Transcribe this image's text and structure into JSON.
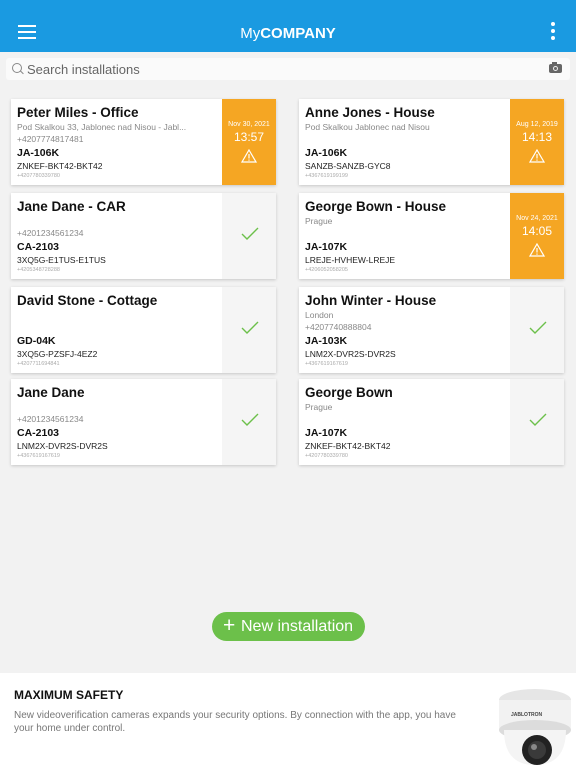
{
  "header": {
    "brand_light": "My",
    "brand_bold": "COMPANY",
    "background": "#1a9ae1"
  },
  "search": {
    "placeholder": "Search installations"
  },
  "installations": [
    {
      "title": "Peter Miles - Office",
      "address": "Pod Skalkou 33, Jablonec nad Nisou - Jabl...",
      "phone": "+4207774817481",
      "model": "JA-106K",
      "code": "ZNKEF-BKT42-BKT42",
      "tiny": "+4207780339780",
      "status": "alert",
      "date": "Nov 30, 2021",
      "time": "13:57"
    },
    {
      "title": "Anne Jones - House",
      "address": "Pod Skalkou Jablonec nad Nisou",
      "phone": "",
      "model": "JA-106K",
      "code": "SANZB-SANZB-GYC8",
      "tiny": "+4367619199199",
      "status": "alert",
      "date": "Aug 12, 2019",
      "time": "14:13"
    },
    {
      "title": "Jane Dane - CAR",
      "address": "",
      "phone": "+4201234561234",
      "model": "CA-2103",
      "code": "3XQ5G-E1TUS-E1TUS",
      "tiny": "+4205348728288",
      "status": "ok"
    },
    {
      "title": "George Bown - House",
      "address": "Prague",
      "phone": "",
      "model": "JA-107K",
      "code": "LREJE-HVHEW-LREJE",
      "tiny": "+4206052058205",
      "status": "alert",
      "date": "Nov 24, 2021",
      "time": "14:05"
    },
    {
      "title": "David Stone - Cottage",
      "address": "",
      "phone": "",
      "model": "GD-04K",
      "code": "3XQ5G-PZSFJ-4EZ2",
      "tiny": "+4207711694841",
      "status": "ok"
    },
    {
      "title": "John Winter - House",
      "address": "London",
      "phone": "+4207740888804",
      "model": "JA-103K",
      "code": "LNM2X-DVR2S-DVR2S",
      "tiny": "+4367619167619",
      "status": "ok"
    },
    {
      "title": "Jane Dane",
      "address": "",
      "phone": "+4201234561234",
      "model": "CA-2103",
      "code": "LNM2X-DVR2S-DVR2S",
      "tiny": "+4367619167619",
      "status": "ok"
    },
    {
      "title": "George Bown",
      "address": "Prague",
      "phone": "",
      "model": "JA-107K",
      "code": "ZNKEF-BKT42-BKT42",
      "tiny": "+4207780339780",
      "status": "ok"
    }
  ],
  "new_installation": {
    "label": "New installation",
    "color": "#6cc04a"
  },
  "promo": {
    "title": "MAXIMUM SAFETY",
    "text": "New videoverification cameras expands your security options. By connection with the app, you have your home under control.",
    "camera_brand": "JABLOTRON"
  },
  "colors": {
    "alert": "#f5a623",
    "check": "#6cc04a"
  }
}
